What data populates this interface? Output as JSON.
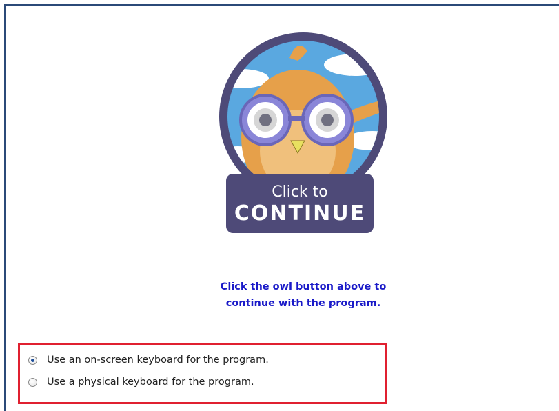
{
  "owl_button": {
    "line1": "Click to",
    "line2": "CONTINUE"
  },
  "instruction": {
    "line1": "Click the owl button above to",
    "line2": "continue with the program."
  },
  "keyboard_options": [
    {
      "label": "Use an on-screen keyboard for the program.",
      "selected": true
    },
    {
      "label": "Use a physical keyboard for the program.",
      "selected": false
    }
  ],
  "colors": {
    "instruction_text": "#1a1ac8",
    "highlight_border": "#e02030",
    "badge": "#4e4a78"
  }
}
